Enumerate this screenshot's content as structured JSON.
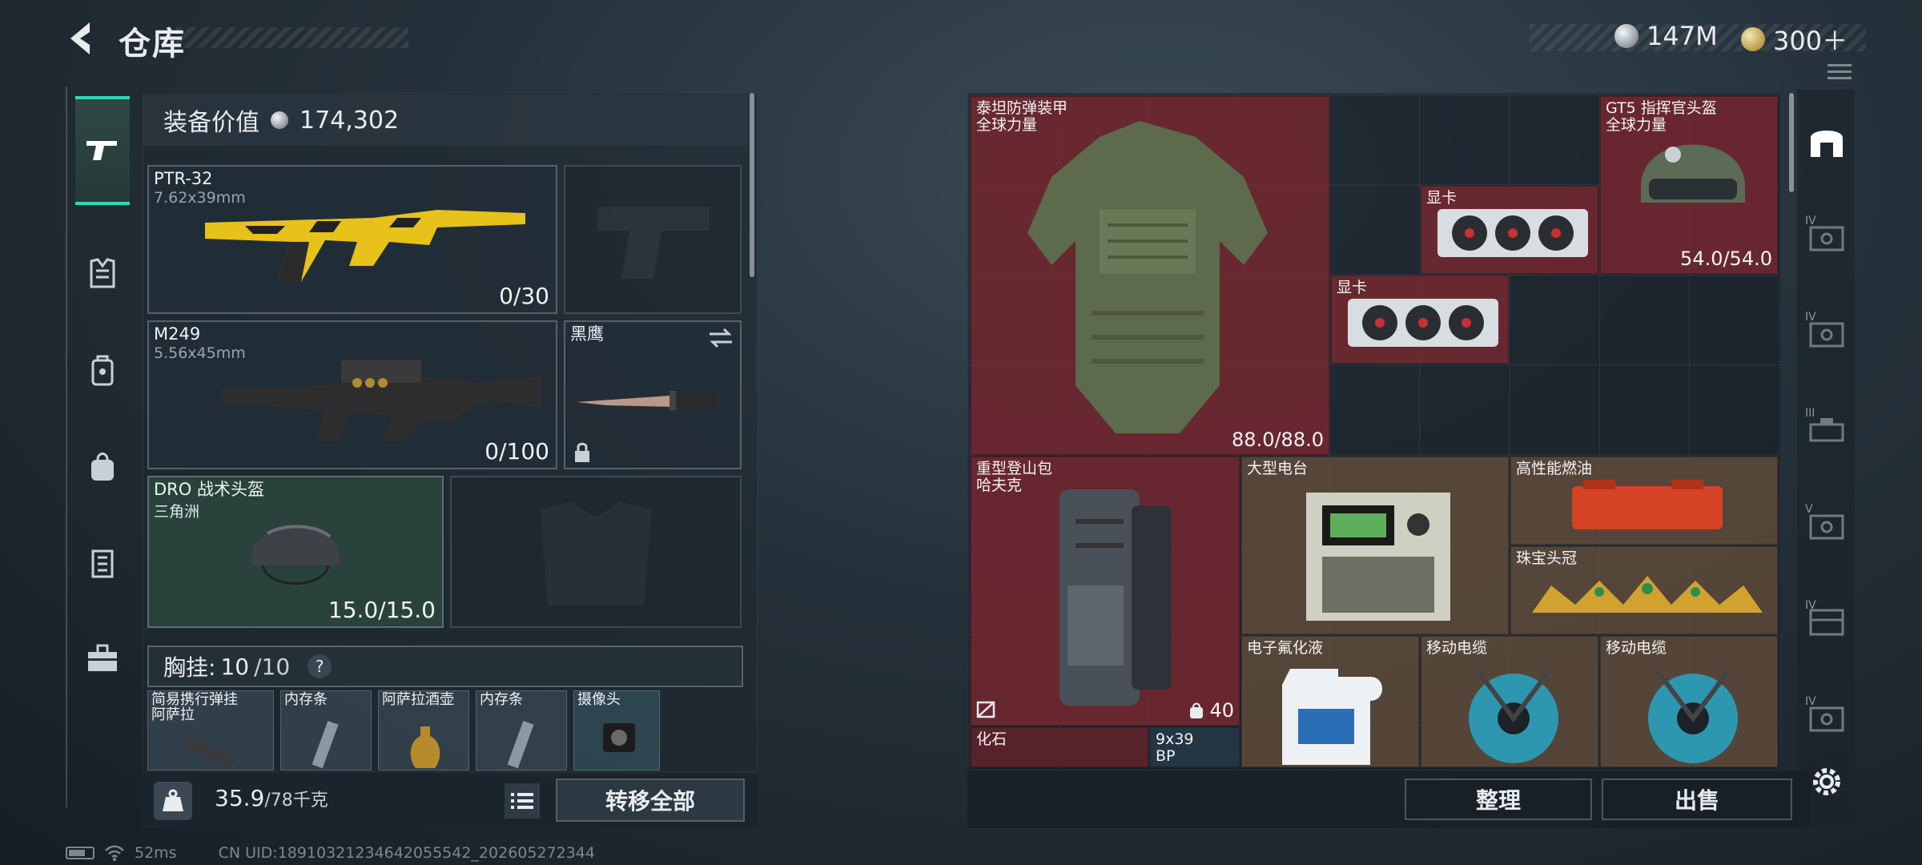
{
  "header": {
    "title": "仓库"
  },
  "currency": {
    "silver": "147M",
    "gold": "300＋"
  },
  "equipment": {
    "value_label": "装备价值",
    "value": "174,302",
    "primary_weapon": {
      "name": "PTR-32",
      "caliber": "7.62x39mm",
      "ammo": "0/30"
    },
    "secondary_weapon": {
      "name": "M249",
      "caliber": "5.56x45mm",
      "ammo": "0/100"
    },
    "melee": {
      "name": "黑鹰"
    },
    "helmet": {
      "name": "DRO 战术头盔",
      "map": "三角洲",
      "durability": "15.0/15.0"
    },
    "vest": {
      "label": "胸挂:",
      "used": "10",
      "total": "/10",
      "help": "?"
    },
    "vest_items": [
      {
        "name": "简易携行弹挂\n阿萨拉"
      },
      {
        "name": "内存条"
      },
      {
        "name": "阿萨拉酒壶"
      },
      {
        "name": "内存条"
      },
      {
        "name": "摄像头"
      }
    ],
    "weight": {
      "current": "35.9",
      "max": "/78千克"
    },
    "transfer_all": "转移全部"
  },
  "status": {
    "ping": "52ms",
    "uid": "CN UID:18910321234642055542_202605272344"
  },
  "stash": {
    "items": [
      {
        "id": "armor",
        "name": "泰坦防弹装甲\n全球力量",
        "value": "88.0/88.0",
        "color": "red"
      },
      {
        "id": "helmet",
        "name": "GT5 指挥官头盔\n全球力量",
        "value": "54.0/54.0",
        "color": "red"
      },
      {
        "id": "gpu1",
        "name": "显卡",
        "value": "",
        "color": "red"
      },
      {
        "id": "gpu2",
        "name": "显卡",
        "value": "",
        "color": "red"
      },
      {
        "id": "backpack",
        "name": "重型登山包\n哈夫克",
        "value": "40",
        "color": "red"
      },
      {
        "id": "radio",
        "name": "大型电台",
        "value": "",
        "color": "gold"
      },
      {
        "id": "fuel",
        "name": "高性能燃油",
        "value": "",
        "color": "gold"
      },
      {
        "id": "crown",
        "name": "珠宝头冠",
        "value": "",
        "color": "gold"
      },
      {
        "id": "coolant",
        "name": "电子氟化液",
        "value": "",
        "color": "gold"
      },
      {
        "id": "cable1",
        "name": "移动电缆",
        "value": "",
        "color": "gold"
      },
      {
        "id": "cable2",
        "name": "移动电缆",
        "value": "",
        "color": "gold"
      },
      {
        "id": "fossil",
        "name": "化石",
        "value": "",
        "color": "red"
      },
      {
        "id": "ammo",
        "name": "9x39\nBP",
        "value": "",
        "color": "blue"
      }
    ],
    "sort": "整理",
    "sell": "出售"
  },
  "right_tabs": [
    "IV",
    "IV",
    "III",
    "V",
    "IV",
    "IV"
  ],
  "colors": {
    "accent": "#2fd8b4",
    "red_cell": "#76282f",
    "gold_cell": "#68523e"
  }
}
